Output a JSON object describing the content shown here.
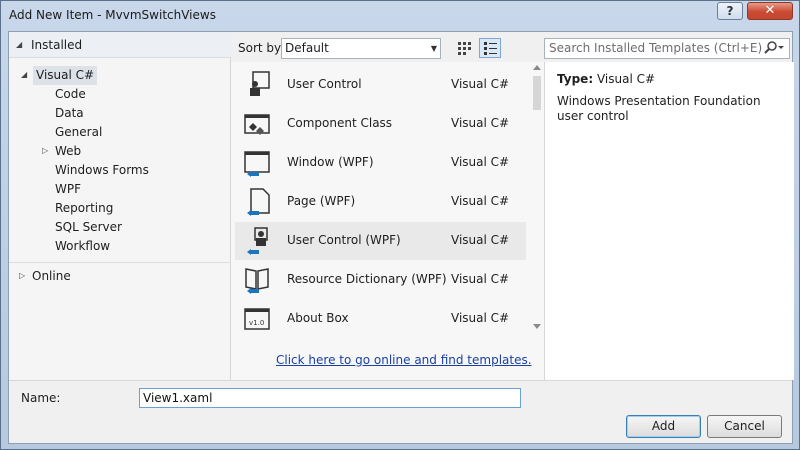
{
  "window": {
    "title": "Add New Item - MvvmSwitchViews",
    "help_label": "?",
    "close_label": "✕"
  },
  "tree": {
    "installed_label": "Installed",
    "root_label": "Visual C#",
    "children": [
      "Code",
      "Data",
      "General",
      "Web",
      "Windows Forms",
      "WPF",
      "Reporting",
      "SQL Server",
      "Workflow"
    ],
    "online_label": "Online"
  },
  "toolbar": {
    "sort_label": "Sort by:",
    "sort_value": "Default"
  },
  "search": {
    "placeholder": "Search Installed Templates (Ctrl+E)"
  },
  "templates": [
    {
      "name": "User Control",
      "lang": "Visual C#",
      "icon": "user-control-icon"
    },
    {
      "name": "Component Class",
      "lang": "Visual C#",
      "icon": "component-class-icon"
    },
    {
      "name": "Window (WPF)",
      "lang": "Visual C#",
      "icon": "window-wpf-icon"
    },
    {
      "name": "Page (WPF)",
      "lang": "Visual C#",
      "icon": "page-wpf-icon"
    },
    {
      "name": "User Control (WPF)",
      "lang": "Visual C#",
      "icon": "user-control-wpf-icon",
      "selected": true
    },
    {
      "name": "Resource Dictionary (WPF)",
      "lang": "Visual C#",
      "icon": "resource-dictionary-icon"
    },
    {
      "name": "About Box",
      "lang": "Visual C#",
      "icon": "about-box-icon"
    }
  ],
  "online_link": "Click here to go online and find templates.",
  "details": {
    "type_label": "Type:",
    "type_value": "Visual C#",
    "description": "Windows Presentation Foundation user control"
  },
  "form": {
    "name_label": "Name:",
    "name_value": "View1.xaml",
    "add_label": "Add",
    "cancel_label": "Cancel"
  },
  "colors": {
    "link": "#1a3fa5",
    "selected_row": "#e9e9e9"
  }
}
